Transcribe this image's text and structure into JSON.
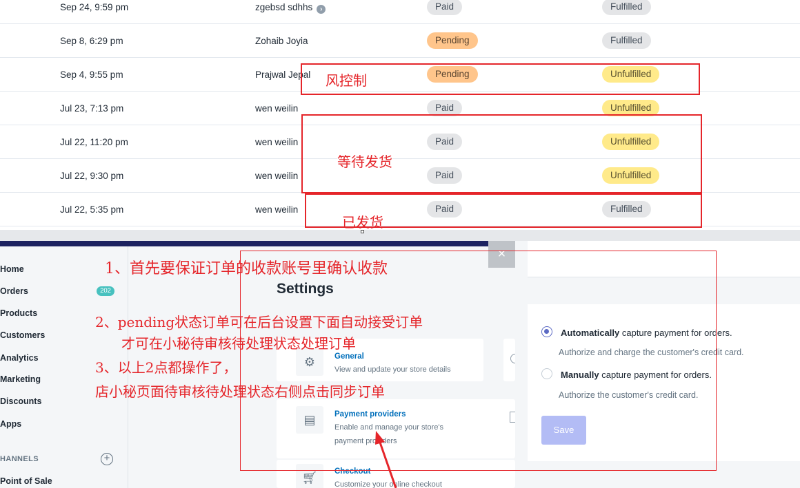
{
  "orders": [
    {
      "date": "Sep 24, 9:59 pm",
      "customer": "zgebsd sdhhs",
      "has_info_icon": true,
      "payment": "Paid",
      "payment_color": "grey",
      "fulfillment": "Fulfilled",
      "fulfillment_color": "grey"
    },
    {
      "date": "Sep 8, 6:29 pm",
      "customer": "Zohaib Joyia",
      "has_info_icon": false,
      "payment": "Pending",
      "payment_color": "orange",
      "fulfillment": "Fulfilled",
      "fulfillment_color": "grey"
    },
    {
      "date": "Sep 4, 9:55 pm",
      "customer": "Prajwal Jepal",
      "has_info_icon": false,
      "payment": "Pending",
      "payment_color": "orange",
      "fulfillment": "Unfulfilled",
      "fulfillment_color": "yellow"
    },
    {
      "date": "Jul 23, 7:13 pm",
      "customer": "wen weilin",
      "has_info_icon": false,
      "payment": "Paid",
      "payment_color": "grey",
      "fulfillment": "Unfulfilled",
      "fulfillment_color": "yellow"
    },
    {
      "date": "Jul 22, 11:20 pm",
      "customer": "wen weilin",
      "has_info_icon": false,
      "payment": "Paid",
      "payment_color": "grey",
      "fulfillment": "Unfulfilled",
      "fulfillment_color": "yellow"
    },
    {
      "date": "Jul 22, 9:30 pm",
      "customer": "wen weilin",
      "has_info_icon": false,
      "payment": "Paid",
      "payment_color": "grey",
      "fulfillment": "Unfulfilled",
      "fulfillment_color": "yellow"
    },
    {
      "date": "Jul 22, 5:35 pm",
      "customer": "wen weilin",
      "has_info_icon": false,
      "payment": "Paid",
      "payment_color": "grey",
      "fulfillment": "Fulfilled",
      "fulfillment_color": "grey"
    }
  ],
  "annotations": {
    "risk_control": "风控制",
    "awaiting_shipment": "等待发货",
    "shipped": "已发货",
    "step1": "1、首先要保证订单的收款账号里确认收款",
    "step2_line1": "2、pending状态订单可在后台设置下面自动接受订单",
    "step2_line2": "才可在小秘待审核待处理状态处理订单",
    "step3_line1": "3、以上2点都操作了，",
    "step3_line2": "店小秘页面待审核待处理状态右侧点击同步订单"
  },
  "sidebar": {
    "items": [
      {
        "label": "Home"
      },
      {
        "label": "Orders",
        "badge": "202"
      },
      {
        "label": "Products"
      },
      {
        "label": "Customers"
      },
      {
        "label": "Analytics"
      },
      {
        "label": "Marketing"
      },
      {
        "label": "Discounts"
      },
      {
        "label": "Apps"
      }
    ],
    "channels_label": "HANNELS",
    "point_of_sale": "Point of Sale"
  },
  "settings": {
    "title": "Settings",
    "close": "×",
    "cards": [
      {
        "title": "General",
        "desc": "View and update your store details",
        "icon": "gear-icon"
      },
      {
        "title": "Payment providers",
        "desc_line1": "Enable and manage your store's",
        "desc_line2": "payment providers",
        "icon": "payment-icon"
      },
      {
        "title": "Checkout",
        "desc": "Customize your online checkout",
        "icon": "cart-icon"
      }
    ]
  },
  "payment_capture": {
    "option1_bold": "Automatically",
    "option1_rest": " capture payment for orders.",
    "option1_help": "Authorize and charge the customer's credit card.",
    "option2_bold": "Manually",
    "option2_rest": " capture payment for orders.",
    "option2_help": "Authorize the customer's credit card.",
    "selected": "automatic",
    "save_label": "Save"
  },
  "colors": {
    "annotation_red": "#e5252a",
    "paid_badge": "#e4e5e7",
    "pending_badge": "#ffc58b",
    "unfulfilled_badge": "#ffea8a",
    "link_blue": "#006fbb",
    "radio_accent": "#5c6ac4",
    "save_disabled": "#b3bcf5"
  }
}
